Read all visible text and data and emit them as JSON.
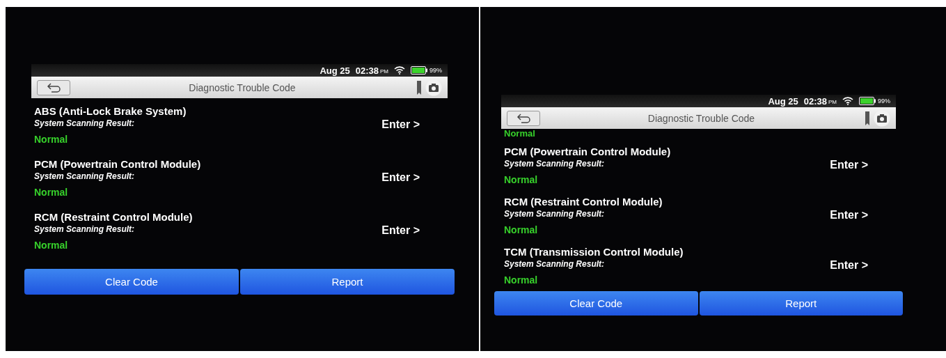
{
  "screens": [
    {
      "status": {
        "date": "Aug 25",
        "time": "02:38",
        "meridiem": "PM",
        "battery": "99%"
      },
      "title": "Diagnostic Trouble Code",
      "rows": [
        {
          "name": "ABS (Anti-Lock Brake System)",
          "label": "System Scanning Result:",
          "result": "Normal",
          "action": "Enter >"
        },
        {
          "name": "PCM (Powertrain Control Module)",
          "label": "System Scanning Result:",
          "result": "Normal",
          "action": "Enter >"
        },
        {
          "name": "RCM (Restraint Control Module)",
          "label": "System Scanning Result:",
          "result": "Normal",
          "action": "Enter >"
        }
      ],
      "buttons": [
        "Clear Code",
        "Report"
      ]
    },
    {
      "status": {
        "date": "Aug 25",
        "time": "02:38",
        "meridiem": "PM",
        "battery": "99%"
      },
      "title": "Diagnostic Trouble Code",
      "leading_result": "Normal",
      "rows": [
        {
          "name": "PCM (Powertrain Control Module)",
          "label": "System Scanning Result:",
          "result": "Normal",
          "action": "Enter >"
        },
        {
          "name": "RCM (Restraint Control Module)",
          "label": "System Scanning Result:",
          "result": "Normal",
          "action": "Enter >"
        },
        {
          "name": "TCM (Transmission Control Module)",
          "label": "System Scanning Result:",
          "result": "Normal",
          "action": "Enter >"
        }
      ],
      "buttons": [
        "Clear Code",
        "Report"
      ]
    }
  ]
}
